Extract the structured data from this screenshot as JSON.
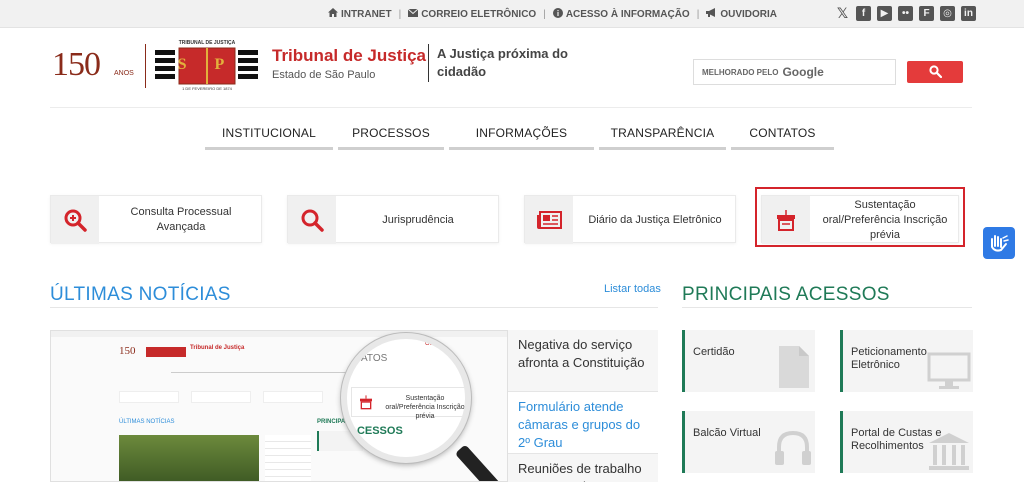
{
  "topbar": {
    "links": [
      {
        "label": "INTRANET",
        "icon": "home-icon"
      },
      {
        "label": "CORREIO ELETRÔNICO",
        "icon": "envelope-icon"
      },
      {
        "label": "ACESSO À INFORMAÇÃO",
        "icon": "info-icon"
      },
      {
        "label": "OUVIDORIA",
        "icon": "megaphone-icon"
      }
    ],
    "social": [
      {
        "glyph": "𝕏",
        "icon": "x-icon"
      },
      {
        "glyph": "f",
        "icon": "facebook-icon"
      },
      {
        "glyph": "▶",
        "icon": "youtube-icon"
      },
      {
        "glyph": "••",
        "icon": "flickr-icon"
      },
      {
        "glyph": "F",
        "icon": "flipboard-icon"
      },
      {
        "glyph": "◎",
        "icon": "instagram-icon"
      },
      {
        "glyph": "in",
        "icon": "linkedin-icon"
      }
    ]
  },
  "header": {
    "logo_number": "150",
    "logo_anos": "ANOS",
    "crest_top": "TRIBUNAL DE JUSTIÇA",
    "crest_letters": "S P",
    "crest_bottom": "1 DE FEVEREIRO DE 1874",
    "title": "Tribunal de Justiça",
    "subtitle": "Estado de São Paulo",
    "tagline": "A Justiça próxima do cidadão"
  },
  "search": {
    "prefix": "MELHORADO PELO",
    "brand": "Google",
    "button_icon": "search-icon"
  },
  "nav": {
    "items": [
      "INSTITUCIONAL",
      "PROCESSOS",
      "INFORMAÇÕES",
      "TRANSPARÊNCIA",
      "CONTATOS"
    ]
  },
  "quick": {
    "items": [
      {
        "label": "Consulta Processual Avançada",
        "icon": "zoom-plus-icon"
      },
      {
        "label": "Jurisprudência",
        "icon": "magnifier-icon"
      },
      {
        "label": "Diário da Justiça Eletrônico",
        "icon": "newspaper-icon"
      },
      {
        "label": "Sustentação oral/Preferência Inscrição prévia",
        "icon": "podium-icon"
      }
    ]
  },
  "accessibility": {
    "icon": "sign-language-icon"
  },
  "news": {
    "title": "ÚLTIMAS NOTÍCIAS",
    "list_all": "Listar todas",
    "items": [
      {
        "text": "Negativa do serviço afronta a Constituição"
      },
      {
        "text": "Formulário atende câmaras e grupos do 2º Grau"
      },
      {
        "text": "Reuniões de trabalho e compromissos externos"
      }
    ],
    "thumbnail": {
      "mini_logo": "150",
      "mini_title": "Tribunal de Justiça",
      "mini_heading": "ÚLTIMAS NOTÍCIAS",
      "mini_pa": "PRINCIPAIS ACESSOS",
      "lens_top": "ATOS",
      "lens_corner": "Ouvidoria",
      "lens_card": "Sustentação oral/Preferência Inscrição prévia",
      "lens_bottom": "ACESSOS"
    }
  },
  "main_access": {
    "title": "PRINCIPAIS ACESSOS",
    "items": [
      {
        "label": "Certidão",
        "icon": "document-icon"
      },
      {
        "label": "Peticionamento Eletrônico",
        "icon": "monitor-icon"
      },
      {
        "label": "Balcão Virtual",
        "icon": "headset-icon"
      },
      {
        "label": "Portal de Custas e Recolhimentos",
        "icon": "courthouse-icon"
      }
    ]
  }
}
